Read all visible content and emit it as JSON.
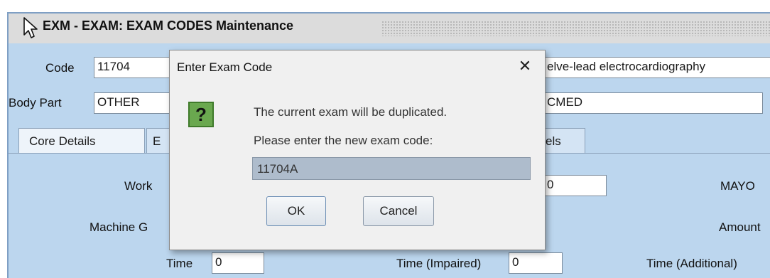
{
  "window": {
    "title": "EXM - EXAM: EXAM CODES Maintenance"
  },
  "form": {
    "code_label": "Code",
    "code_value": "11704",
    "description_value": "elve-lead electrocardiography",
    "body_part_label": "Body Part",
    "body_part_value": "OTHER",
    "department_value": "CMED"
  },
  "tabs": [
    {
      "label": "Core Details",
      "active": true
    },
    {
      "label": "E"
    },
    {
      "label": "els"
    }
  ],
  "core": {
    "work_label": "Work",
    "work_value": "0",
    "mayo_label": "MAYO",
    "machine_label": "Machine G",
    "amount_label": "Amount",
    "time_label": "Time",
    "time_value": "0",
    "time_impaired_label": "Time (Impaired)",
    "time_impaired_value": "0",
    "time_additional_label": "Time (Additional)"
  },
  "dialog": {
    "title": "Enter Exam Code",
    "close_glyph": "✕",
    "icon_glyph": "?",
    "message_line1": "The current exam will be duplicated.",
    "message_line2": "Please enter the new exam code:",
    "input_value": "11704A",
    "ok_label": "OK",
    "cancel_label": "Cancel"
  }
}
